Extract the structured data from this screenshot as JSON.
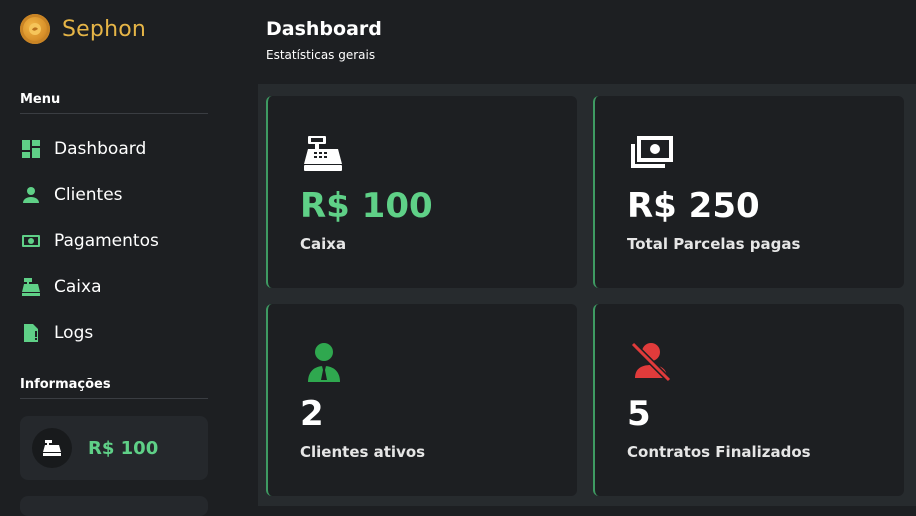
{
  "brand": {
    "name": "Sephon"
  },
  "sidebar": {
    "menu_label": "Menu",
    "items": [
      {
        "label": "Dashboard",
        "icon": "dashboard-icon"
      },
      {
        "label": "Clientes",
        "icon": "user-icon"
      },
      {
        "label": "Pagamentos",
        "icon": "money-icon"
      },
      {
        "label": "Caixa",
        "icon": "cash-register-icon"
      },
      {
        "label": "Logs",
        "icon": "file-alert-icon"
      }
    ],
    "info_label": "Informações",
    "info_card": {
      "value": "R$ 100",
      "icon": "cash-register-icon"
    }
  },
  "header": {
    "title": "Dashboard",
    "subtitle": "Estatísticas gerais"
  },
  "cards": [
    {
      "value": "R$ 100",
      "label": "Caixa",
      "icon": "cash-register-icon"
    },
    {
      "value": "R$ 250",
      "label": "Total Parcelas pagas",
      "icon": "money-bills-icon"
    },
    {
      "value": "2",
      "label": "Clientes ativos",
      "icon": "business-user-icon"
    },
    {
      "value": "5",
      "label": "Contratos Finalizados",
      "icon": "user-slash-icon"
    }
  ],
  "colors": {
    "accent_green": "#5fd087",
    "brand_gold": "#e6b547",
    "alert_red": "#e03b3b",
    "user_green": "#2fa84f",
    "card_bg": "#1d1f22",
    "main_bg": "#272b2e"
  }
}
